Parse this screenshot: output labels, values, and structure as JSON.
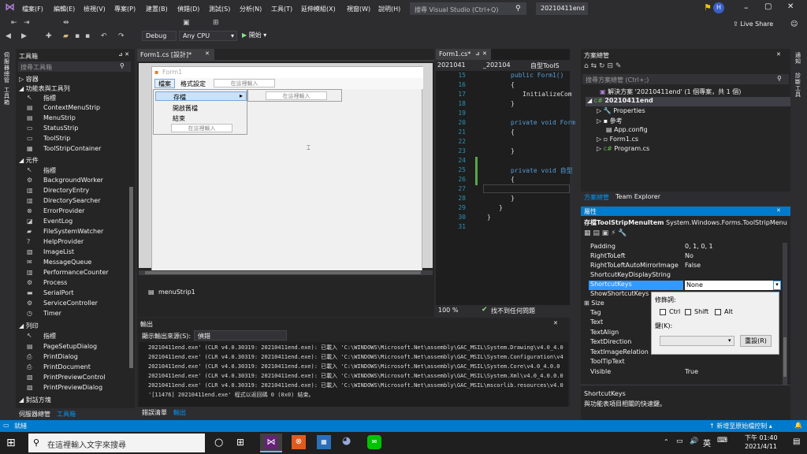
{
  "titlebar": {
    "menus": [
      "檔案(F)",
      "編輯(E)",
      "檢視(V)",
      "專案(P)",
      "建置(B)",
      "偵錯(D)",
      "測試(S)",
      "分析(N)",
      "工具(T)",
      "延伸模組(X)",
      "視窗(W)",
      "說明(H)"
    ],
    "search_placeholder": "搜尋 Visual Studio (Ctrl+Q)",
    "solution_name": "20210411end",
    "avatar_letter": "H"
  },
  "toolbar": {
    "config": "Debug",
    "platform": "Any CPU",
    "start_label": "開始",
    "live_share": "Live Share"
  },
  "leftstrip": {
    "text1": "伺服器總管",
    "text2": "工具箱"
  },
  "toolbox": {
    "title": "工具箱",
    "search_placeholder": "搜尋工具箱",
    "categories": {
      "containers": "▷ 容器",
      "menus": "◢ 功能表與工具列",
      "components": "◢ 元件",
      "printing": "◢ 列印",
      "dialogs": "◢ 對話方塊"
    },
    "menu_items": [
      "指標",
      "ContextMenuStrip",
      "MenuStrip",
      "StatusStrip",
      "ToolStrip",
      "ToolStripContainer"
    ],
    "component_items": [
      "指標",
      "BackgroundWorker",
      "DirectoryEntry",
      "DirectorySearcher",
      "ErrorProvider",
      "EventLog",
      "FileSystemWatcher",
      "HelpProvider",
      "ImageList",
      "MessageQueue",
      "PerformanceCounter",
      "Process",
      "SerialPort",
      "ServiceController",
      "Timer"
    ],
    "print_items": [
      "指標",
      "PageSetupDialog",
      "PrintDialog",
      "PrintDocument",
      "PrintPreviewControl",
      "PrintPreviewDialog"
    ],
    "bottom_tabs": [
      "伺服器總管",
      "工具箱"
    ]
  },
  "designer": {
    "tab_title": "Form1.cs [設計]*",
    "form_title": "Form1",
    "menu_top": [
      "檔案",
      "格式設定"
    ],
    "type_here": "在這裡輸入",
    "dropdown_items": [
      "存檔",
      "開啟舊檔",
      "結束"
    ],
    "component_tray": "menuStrip1"
  },
  "code": {
    "tab_title": "Form1.cs*",
    "nav1": "2021041",
    "nav2": "_202104",
    "nav3": "自型ToolS",
    "line_numbers": [
      "15",
      "16",
      "17",
      "18",
      "19",
      "20",
      "21",
      "22",
      "23",
      "24",
      "25",
      "26",
      "27",
      "28",
      "29",
      "30",
      "31"
    ],
    "lines": {
      "l15": "public Form1()",
      "l16": "{",
      "l17": "InitializeCom",
      "l18": "}",
      "l20": "private void Form",
      "l21": "{",
      "l23": "}",
      "l25": "private void 自型",
      "l26": "{",
      "l28": "}",
      "l29": "}",
      "l30": "}"
    },
    "zoom": "100 %",
    "status": "找不到任何問題"
  },
  "output": {
    "title": "輸出",
    "source_label": "顯示輸出來源(S):",
    "source_value": "偵錯",
    "lines": [
      "20210411end.exe' (CLR v4.0.30319: 20210411end.exe): 已載入 'C:\\WINDOWS\\Microsoft.Net\\assembly\\GAC_MSIL\\System.Drawing\\v4.0_4.0",
      "20210411end.exe' (CLR v4.0.30319: 20210411end.exe): 已載入 'C:\\WINDOWS\\Microsoft.Net\\assembly\\GAC_MSIL\\System.Configuration\\v4",
      "20210411end.exe' (CLR v4.0.30319: 20210411end.exe): 已載入 'C:\\WINDOWS\\Microsoft.Net\\assembly\\GAC_MSIL\\System.Core\\v4.0_4.0.0",
      "20210411end.exe' (CLR v4.0.30319: 20210411end.exe): 已載入 'C:\\WINDOWS\\Microsoft.Net\\assembly\\GAC_MSIL\\System.Xml\\v4.0_4.0.0.0",
      "20210411end.exe' (CLR v4.0.30319: 20210411end.exe): 已載入 'C:\\WINDOWS\\Microsoft.Net\\assembly\\GAC_MSIL\\mscorlib.resources\\v4.0",
      "'[11476] 20210411end.exe' 程式以返回碼 0 (0x0) 結束。"
    ],
    "bottom_tabs": [
      "錯誤清單",
      "輸出"
    ]
  },
  "solution": {
    "title": "方案總管",
    "search_placeholder": "搜尋方案總管 (Ctrl+;)",
    "solution_line": "解決方案 '20210411end' (1 個專案，共 1 個)",
    "project": "20210411end",
    "items": [
      "Properties",
      "參考",
      "App.config",
      "Form1.cs",
      "Program.cs"
    ],
    "bottom_tabs": [
      "方案總管",
      "Team Explorer"
    ]
  },
  "properties": {
    "title": "屬性",
    "object": "存檔ToolStripMenuItem",
    "object_type": "System.Windows.Forms.ToolStripMenuIt",
    "rows": [
      {
        "name": "Padding",
        "value": "0, 1, 0, 1"
      },
      {
        "name": "RightToLeft",
        "value": "No"
      },
      {
        "name": "RightToLeftAutoMirrorImage",
        "value": "False"
      },
      {
        "name": "ShortcutKeyDisplayString",
        "value": ""
      },
      {
        "name": "ShortcutKeys",
        "value": "None"
      },
      {
        "name": "ShowShortcutKeys",
        "value": ""
      },
      {
        "name": "Size",
        "value": ""
      },
      {
        "name": "Tag",
        "value": ""
      },
      {
        "name": "Text",
        "value": ""
      },
      {
        "name": "TextAlign",
        "value": ""
      },
      {
        "name": "TextDirection",
        "value": ""
      },
      {
        "name": "TextImageRelation",
        "value": ""
      },
      {
        "name": "ToolTipText",
        "value": ""
      },
      {
        "name": "Visible",
        "value": "True"
      }
    ],
    "desc_title": "ShortcutKeys",
    "desc_text": "與功能表項目相關的快速鍵。",
    "popup": {
      "modifiers_label": "修飾詞:",
      "ctrl": "Ctrl",
      "shift": "Shift",
      "alt": "Alt",
      "key_label": "鍵(K):",
      "reset": "重設(R)"
    }
  },
  "rightstrip": {
    "text1": "通知",
    "text2": "診斷工具"
  },
  "statusbar": {
    "ready": "就緒",
    "source_control": "新增至原始檔控制"
  },
  "taskbar": {
    "search_placeholder": "在這裡輸入文字來搜尋",
    "ime": "英",
    "time": "下午 01:40",
    "date": "2021/4/11"
  },
  "colors": {
    "accent": "#007acc",
    "vs_purple": "#68217a",
    "highlight": "#3399ff"
  }
}
